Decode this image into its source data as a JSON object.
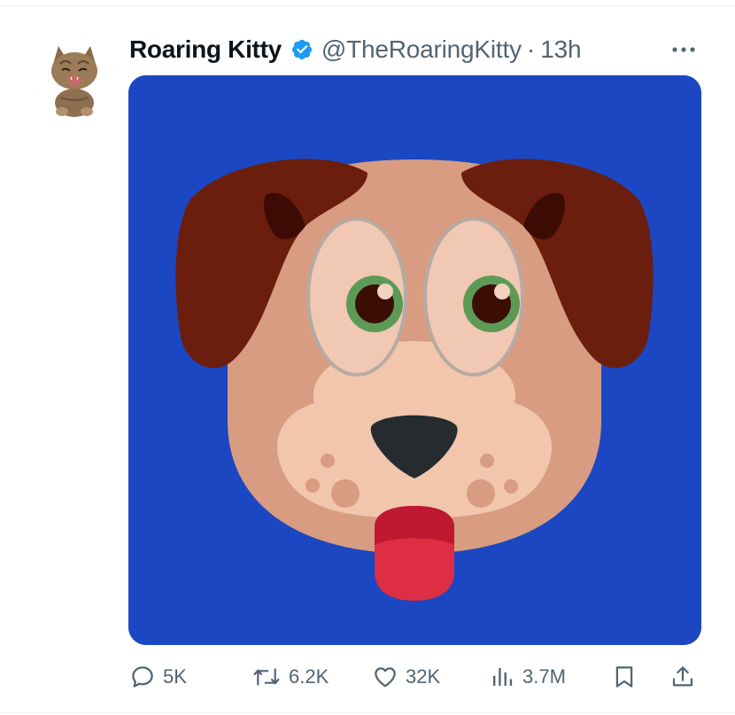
{
  "tweet": {
    "author": {
      "display_name": "Roaring Kitty",
      "handle": "@TheRoaringKitty",
      "verified": true,
      "avatar": "kitten-avatar"
    },
    "separator": "·",
    "time": "13h",
    "media": {
      "subject": "dog-face-emoji",
      "background_color": "#1c47c2"
    },
    "actions": {
      "reply": {
        "icon": "reply-icon",
        "count": "5K"
      },
      "retweet": {
        "icon": "retweet-icon",
        "count": "6.2K"
      },
      "like": {
        "icon": "heart-icon",
        "count": "32K"
      },
      "views": {
        "icon": "views-icon",
        "count": "3.7M"
      },
      "bookmark": {
        "icon": "bookmark-icon"
      },
      "share": {
        "icon": "share-icon"
      }
    }
  },
  "colors": {
    "verified": "#1d9bf0",
    "muted_text": "#536471",
    "primary_text": "#0f1419"
  }
}
